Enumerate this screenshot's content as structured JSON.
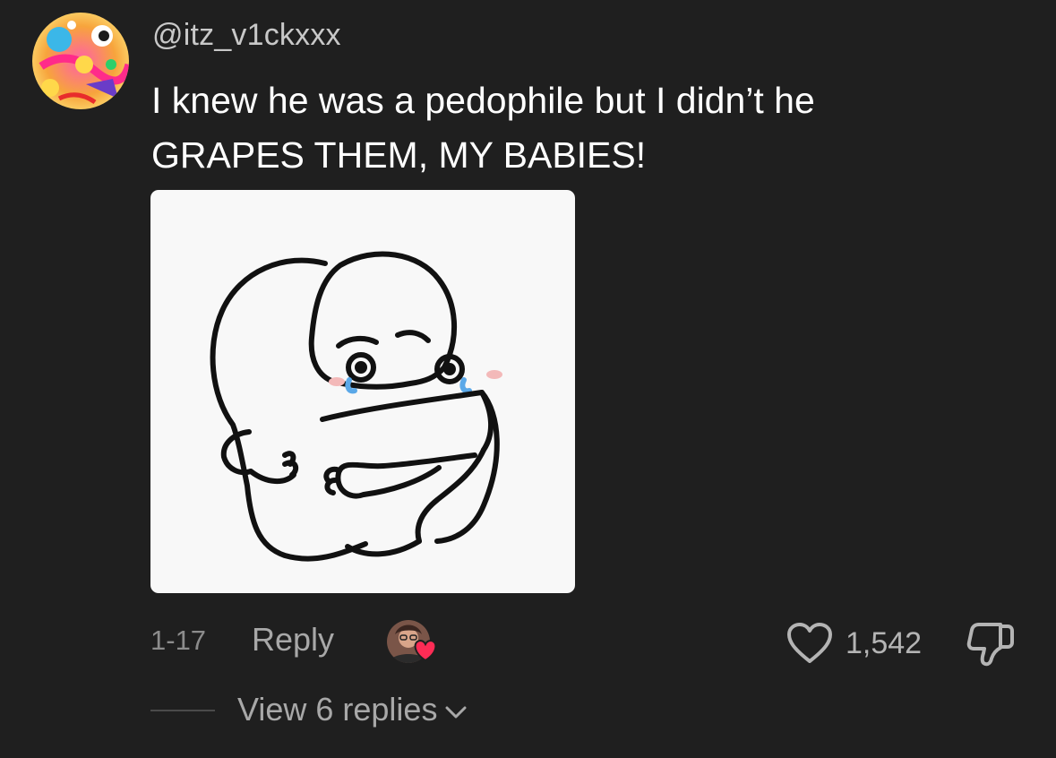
{
  "comment": {
    "username": "@itz_v1ckxxx",
    "text_lines": [
      "I knew he was a pedophile but I didn’t he",
      "GRAPES THEM, MY BABIES!"
    ],
    "sticker_icon": "crying-hug-sticker",
    "date": "1-17",
    "reply_label": "Reply",
    "likes": "1,542",
    "view_replies_label": "View 6 replies"
  },
  "icons": {
    "avatar": "colorful-avatar",
    "creator_heart": "creator-liked-heart-icon",
    "like": "heart-outline-icon",
    "dislike": "thumbs-down-icon",
    "expand": "chevron-down-icon"
  },
  "colors": {
    "background": "#1f1f1f",
    "heart_accent": "#fe2c55",
    "muted_text": "#a8a8a8"
  }
}
